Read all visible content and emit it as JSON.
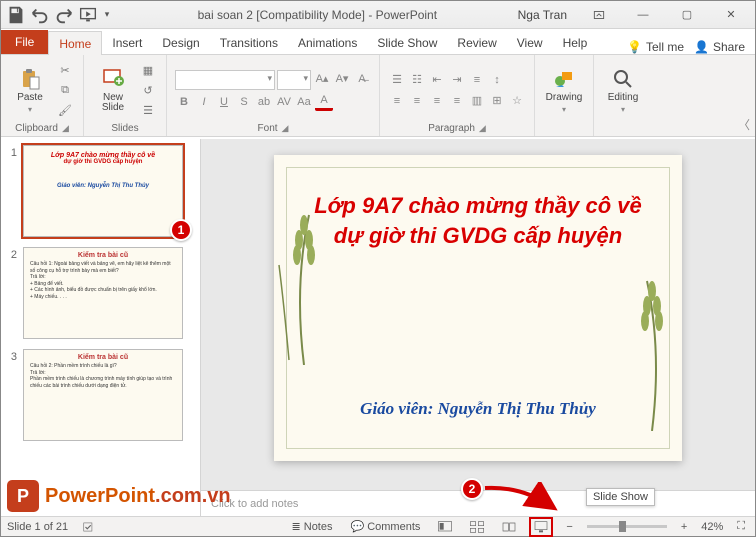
{
  "titlebar": {
    "doc_title": "bai soan 2 [Compatibility Mode]  -  PowerPoint",
    "user": "Nga Tran"
  },
  "tabs": {
    "file": "File",
    "list": [
      "Home",
      "Insert",
      "Design",
      "Transitions",
      "Animations",
      "Slide Show",
      "Review",
      "View",
      "Help"
    ],
    "tellme": "Tell me",
    "share": "Share"
  },
  "ribbon": {
    "clipboard": {
      "paste": "Paste",
      "label": "Clipboard"
    },
    "slides": {
      "newslide": "New\nSlide",
      "label": "Slides"
    },
    "font": {
      "label": "Font"
    },
    "paragraph": {
      "label": "Paragraph"
    },
    "drawing": {
      "label": "Drawing"
    },
    "editing": {
      "label": "Editing"
    }
  },
  "thumbs": {
    "t1": {
      "num": "1",
      "l1": "Lớp 9A7 chào mừng thầy cô về",
      "l2": "dự giờ thi GVDG cấp huyện",
      "l3": "Giáo viên: Nguyễn Thị Thu Thủy"
    },
    "t2": {
      "num": "2",
      "cap": "Kiểm tra bài cũ",
      "body": "Câu hỏi 1: Ngoài bảng viết và bảng vẽ, em hãy liệt kê thêm một số công cụ hỗ trợ trình bày mà em biết?\nTrả lời:\n+ Bảng để viết.\n+ Các hình ảnh, biểu đồ được chuẩn bị trên giấy khổ lớn.\n+ Máy chiếu. . . ."
    },
    "t3": {
      "num": "3",
      "cap": "Kiểm tra bài cũ",
      "body": "Câu hỏi 2: Phần mềm trình chiếu là gì?\nTrả lời:\nPhần mềm trình chiếu là chương trình máy tính giúp tạo và trình chiếu các bài trình chiếu dưới dạng điện tử."
    }
  },
  "slide": {
    "title_l1": "Lớp 9A7 chào mừng thầy cô về",
    "title_l2": "dự giờ thi GVDG cấp huyện",
    "sub": "Giáo viên: Nguyễn Thị Thu Thủy"
  },
  "notes": {
    "placeholder": "Click to add notes"
  },
  "status": {
    "slide_of": "Slide 1 of 21",
    "lang": "",
    "notes": "Notes",
    "comments": "Comments",
    "zoom": "42%"
  },
  "tooltip": {
    "slideshow": "Slide Show"
  },
  "badges": {
    "one": "1",
    "two": "2"
  },
  "watermark": {
    "a": "PowerPoint",
    "b": ".com.vn"
  }
}
